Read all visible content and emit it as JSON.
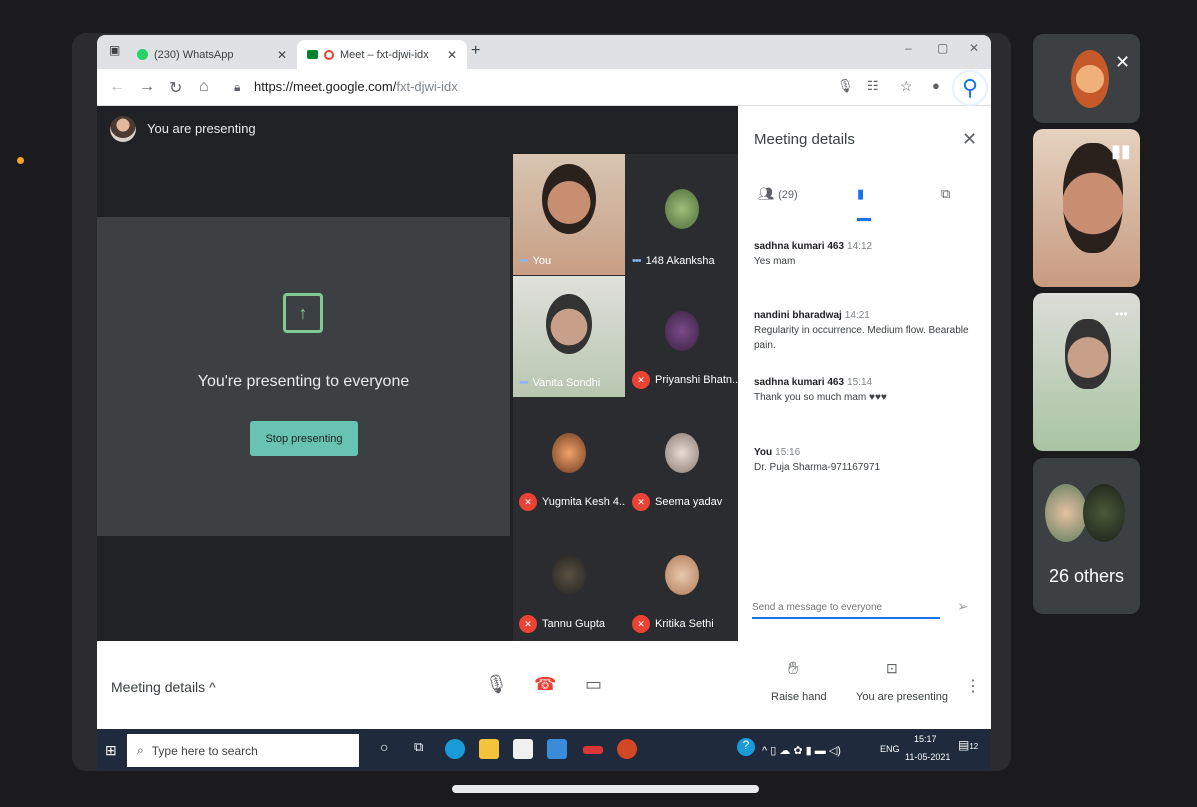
{
  "browser": {
    "tabs": [
      {
        "label": "(230) WhatsApp",
        "active": false
      },
      {
        "label": "Meet – fxt-djwi-idx",
        "active": true
      }
    ],
    "url_host": "https://meet.google.com/",
    "url_path": "fxt-djwi-idx"
  },
  "meet": {
    "top_title": "You are presenting",
    "present_text": "You're presenting to everyone",
    "stop_label": "Stop presenting",
    "tiles": [
      {
        "name": "You",
        "muted": false,
        "dots": true
      },
      {
        "name": "148 Akanksha",
        "muted": false,
        "dots": true
      },
      {
        "name": "Vanita Sondhi",
        "muted": false,
        "dots": true
      },
      {
        "name": "Priyanshi Bhatn...",
        "muted": true
      },
      {
        "name": "Yugmita Kesh 4...",
        "muted": true
      },
      {
        "name": "Seema yadav",
        "muted": true
      },
      {
        "name": "Tannu Gupta",
        "muted": true
      },
      {
        "name": "Kritika Sethi",
        "muted": true
      }
    ]
  },
  "panel": {
    "title": "Meeting details",
    "people_count": "(29)",
    "messages": [
      {
        "who": "sadhna kumari 463",
        "time": "14:12",
        "text": "Yes mam"
      },
      {
        "who": "nandini bharadwaj",
        "time": "14:21",
        "text": "Regularity in occurrence. Medium flow. Bearable pain."
      },
      {
        "who": "sadhna kumari 463",
        "time": "15:14",
        "text": "Thank you so much mam ♥♥♥"
      },
      {
        "who": "You",
        "time": "15:16",
        "text": "Dr. Puja Sharma-971167971"
      }
    ],
    "send_placeholder": "Send a message to everyone"
  },
  "bottom": {
    "meeting_details": "Meeting details",
    "raise_hand": "Raise hand",
    "you_presenting": "You are presenting"
  },
  "taskbar": {
    "search_placeholder": "Type here to search",
    "lang": "ENG",
    "time": "15:17",
    "date": "11-05-2021",
    "notif_count": "12"
  },
  "right": {
    "others_label": "26 others"
  }
}
